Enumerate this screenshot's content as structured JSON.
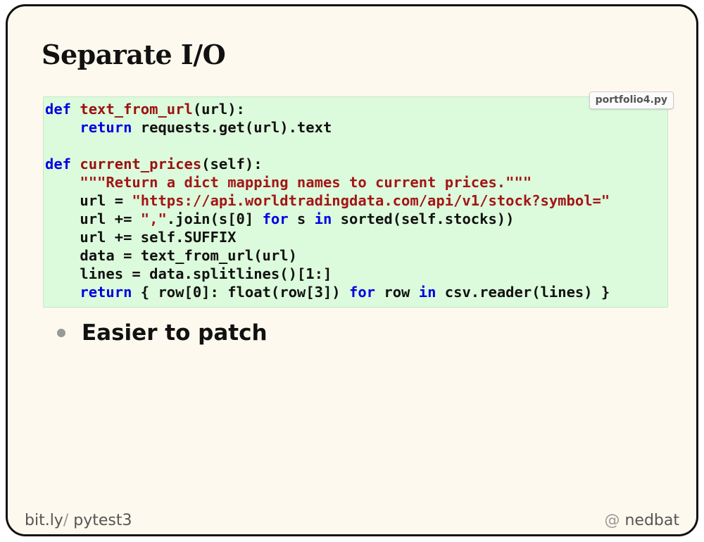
{
  "slide": {
    "title": "Separate I/O",
    "code_block": {
      "filename": "portfolio4.py",
      "lines": [
        "def text_from_url(url):",
        "    return requests.get(url).text",
        "",
        "def current_prices(self):",
        "    \"\"\"Return a dict mapping names to current prices.\"\"\"",
        "    url = \"https://api.worldtradingdata.com/api/v1/stock?symbol=\"",
        "    url += \",\".join(s[0] for s in sorted(self.stocks))",
        "    url += self.SUFFIX",
        "    data = text_from_url(url)",
        "    lines = data.splitlines()[1:]",
        "    return { row[0]: float(row[3]) for row in csv.reader(lines) }"
      ]
    },
    "bullets": [
      "Easier to patch"
    ],
    "footer": {
      "left_prefix": "bit.ly",
      "left_sep": "/",
      "left_suffix": " pytest3",
      "right_at": "@",
      "right_handle": " nedbat"
    }
  },
  "colors": {
    "code_bg": "#dcfadc",
    "keyword": "#0000e0",
    "function_name": "#9b1010",
    "string": "#a31616",
    "slide_bg": "#fef9ee"
  }
}
